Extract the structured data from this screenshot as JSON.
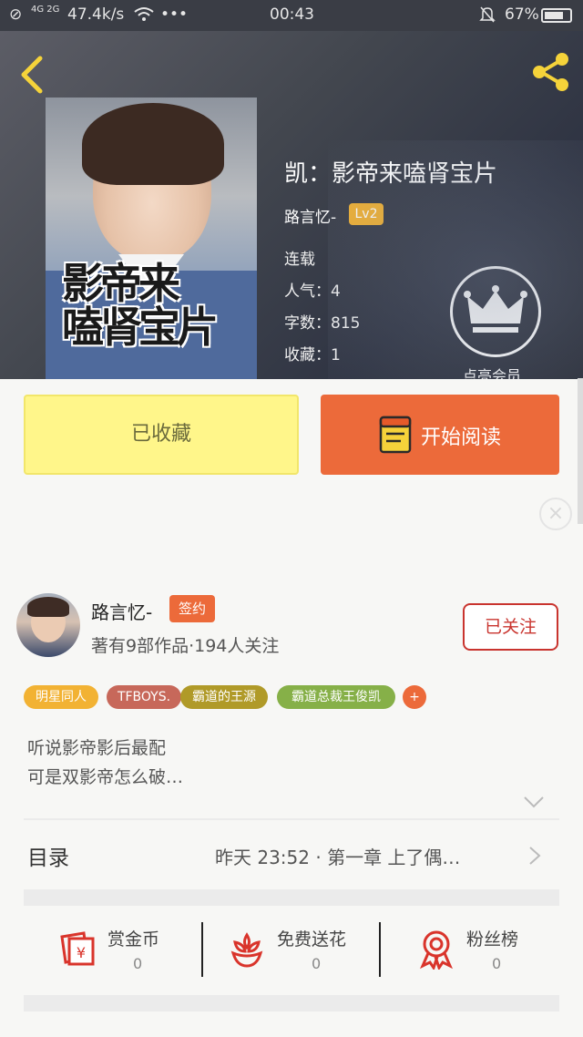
{
  "status_bar": {
    "network": "4G 2G",
    "speed": "47.4k/s",
    "dots": "•••",
    "time": "00:43",
    "battery": "67%"
  },
  "book": {
    "title": "凯：影帝来嗑肾宝片",
    "author": "路言忆-",
    "level": "Lv2",
    "status": "连载",
    "popularity": "人气：4",
    "word_count": "字数：815",
    "favorites": "收藏：1",
    "cover_title": "影帝来\n嗑肾宝片"
  },
  "vip": {
    "label": "点亮会员"
  },
  "actions": {
    "collected_label": "已收藏",
    "read_label": "开始阅读"
  },
  "author_card": {
    "name": "路言忆-",
    "badge": "签约",
    "stats": "著有9部作品·194人关注",
    "follow_label": "已关注"
  },
  "tags": [
    {
      "label": "明星同人",
      "color": "#f2b233"
    },
    {
      "label": "TFBOYS.",
      "color": "#c7685a"
    },
    {
      "label": "霸道的王源",
      "color": "#b09a28"
    },
    {
      "label": "霸道总裁王俊凯",
      "color": "#86b048"
    },
    {
      "label": "+",
      "color": "#ec6a3a"
    }
  ],
  "description": {
    "line1": "听说影帝影后最配",
    "line2": "可是双影帝怎么破…"
  },
  "toc": {
    "label": "目录",
    "latest": "昨天 23:52 · 第一章  上了偶…"
  },
  "rewards": [
    {
      "label": "赏金币",
      "count": "0",
      "icon": "red-envelope-icon"
    },
    {
      "label": "免费送花",
      "count": "0",
      "icon": "flower-icon"
    },
    {
      "label": "粉丝榜",
      "count": "0",
      "icon": "medal-icon"
    }
  ],
  "colors": {
    "accent_orange": "#ec6a3a",
    "collected_yellow": "#fff68a",
    "follow_red": "#c9342e",
    "icon_red": "#d9342b",
    "share_yellow": "#f5d33a"
  }
}
